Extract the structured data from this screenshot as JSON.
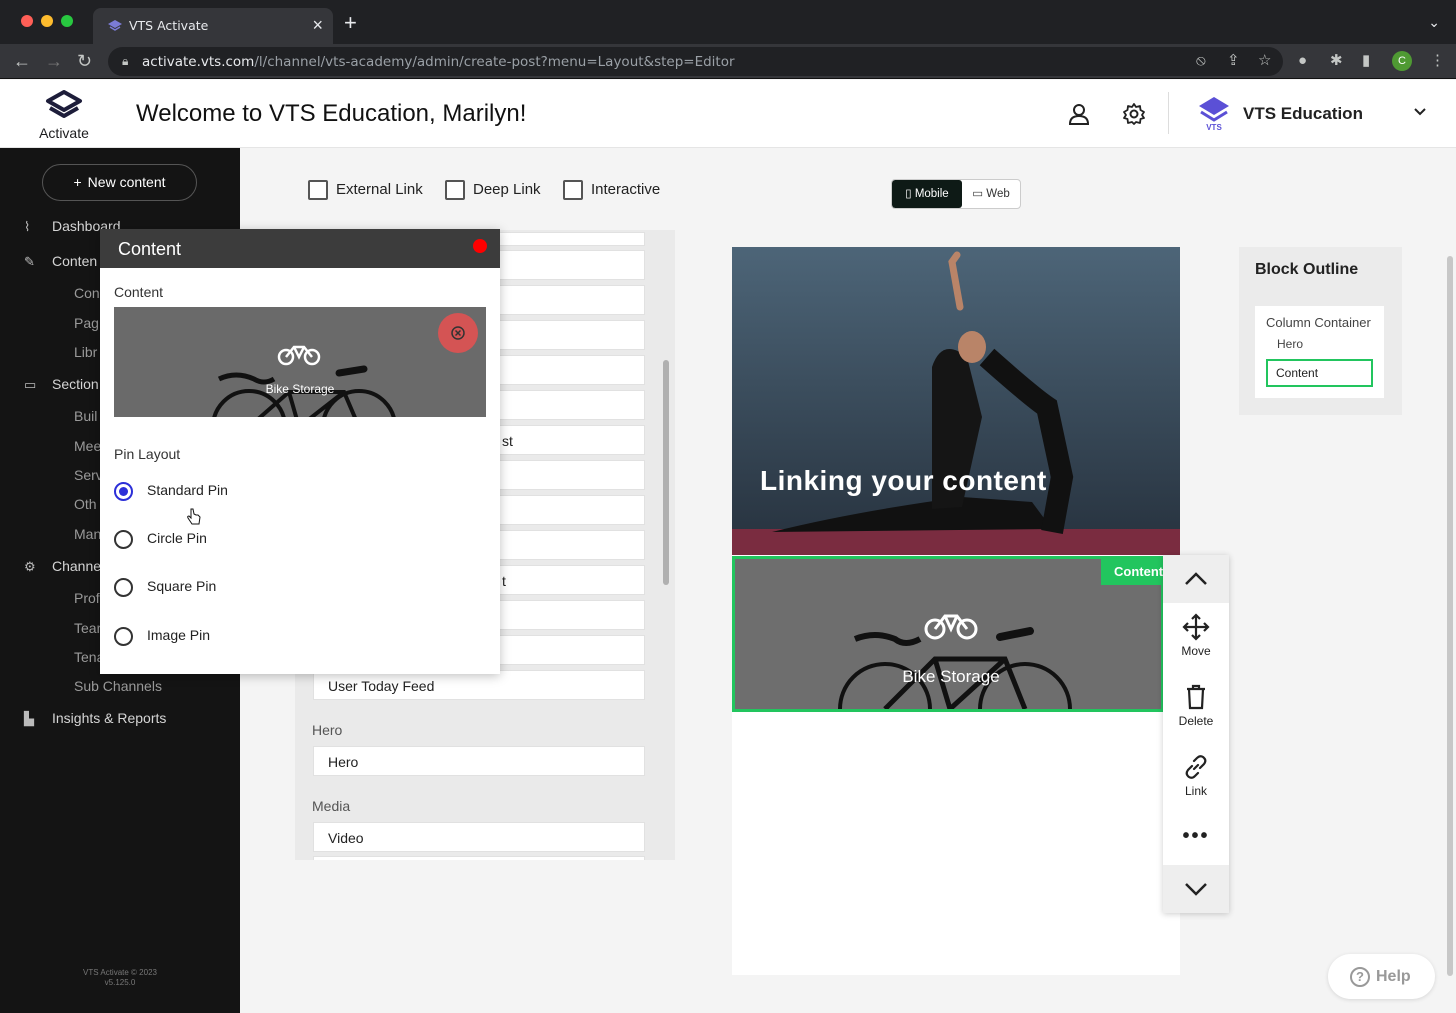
{
  "browser": {
    "tab_title": "VTS Activate",
    "url_host": "activate.vts.com",
    "url_path": "/l/channel/vts-academy/admin/create-post?menu=Layout&step=Editor",
    "profile_initial": "C"
  },
  "header": {
    "logo_text": "Activate",
    "welcome": "Welcome to VTS Education, Marilyn!",
    "org_name": "VTS Education"
  },
  "sidebar": {
    "new_content": "New content",
    "items": [
      {
        "label": "Dashboard"
      },
      {
        "label": "Conten"
      },
      {
        "label": "Con"
      },
      {
        "label": "Pag"
      },
      {
        "label": "Libr"
      },
      {
        "label": "Section"
      },
      {
        "label": "Buil"
      },
      {
        "label": "Mee"
      },
      {
        "label": "Serv"
      },
      {
        "label": "Oth"
      },
      {
        "label": "Man"
      },
      {
        "label": "Channe"
      },
      {
        "label": "Prof"
      },
      {
        "label": "Tear"
      },
      {
        "label": "Tena"
      },
      {
        "label": "Sub Channels"
      },
      {
        "label": "Insights & Reports"
      }
    ],
    "copyright": "VTS Activate © 2023",
    "version": "v5.125.0"
  },
  "options": {
    "external_link": "External Link",
    "deep_link": "Deep Link",
    "interactive": "Interactive"
  },
  "view_toggle": {
    "mobile": "Mobile",
    "web": "Web"
  },
  "blocks": {
    "partial_1": "st",
    "partial_2": "t",
    "user_today_feed": "User Today Feed",
    "hero_label": "Hero",
    "hero_item": "Hero",
    "media_label": "Media",
    "video": "Video"
  },
  "popup": {
    "title": "Content",
    "content_label": "Content",
    "image_caption": "Bike Storage",
    "pin_layout_label": "Pin Layout",
    "pins": [
      {
        "label": "Standard Pin",
        "selected": true
      },
      {
        "label": "Circle Pin",
        "selected": false
      },
      {
        "label": "Square Pin",
        "selected": false
      },
      {
        "label": "Image Pin",
        "selected": false
      }
    ]
  },
  "preview": {
    "hero_text": "Linking your content",
    "content_tag": "Content",
    "content_caption": "Bike Storage"
  },
  "toolbar": {
    "move": "Move",
    "delete": "Delete",
    "link": "Link"
  },
  "outline": {
    "title": "Block Outline",
    "column_container": "Column Container",
    "hero": "Hero",
    "content": "Content"
  },
  "help": "Help",
  "colors": {
    "accent_green": "#22c55e",
    "radio_blue": "#2c2fd8",
    "sidebar_bg": "#141414"
  }
}
